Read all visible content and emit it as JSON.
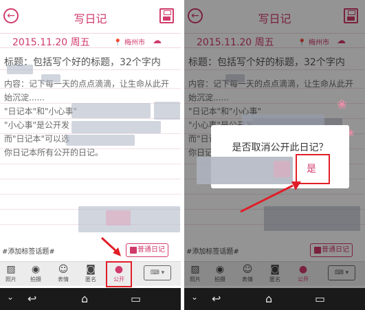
{
  "left": {
    "title": "写日记",
    "date": "2015.11.20 周五",
    "location": "梅州市",
    "weather_icon": "cloud-sun-icon",
    "title_placeholder": "标题：包括写个好的标题，32个字内",
    "content_lines": [
      "内容：记下每一天的点点滴滴，让生命从此开",
      "始沉淀......",
      "\"日记本\"和\"小心事\"",
      "\"小心事\"是公开发",
      "而\"日记本\"可以选",
      "你日记本所有公开的日记。"
    ],
    "tag_placeholder": "#添加标签话题#",
    "normal_diary_button": "普通日记",
    "toolbar": [
      {
        "label": "照片",
        "icon": "image-icon"
      },
      {
        "label": "拍摄",
        "icon": "camera-icon"
      },
      {
        "label": "表情",
        "icon": "smiley-icon"
      },
      {
        "label": "匿名",
        "icon": "anonymous-icon"
      },
      {
        "label": "公开",
        "icon": "people-icon"
      }
    ],
    "keyboard_icon": "keyboard-icon"
  },
  "right": {
    "title": "写日记",
    "date": "2015.11.20 周五",
    "location": "梅州市",
    "title_placeholder": "标题：包括写个好的标题，32个字内",
    "content_lines": [
      "内容：记下每一天的点点滴滴，让生命从此开",
      "始沉淀......",
      "\"日记本\"和\"小心事\"",
      "\"小心事\"是公开发",
      "而\"日记本\"可以",
      "你日记本所有公开"
    ],
    "dialog": {
      "message": "是否取消公开此日记？",
      "confirm": "是"
    },
    "tag_placeholder": "#添加标签话题#",
    "normal_diary_button": "普通日记",
    "toolbar": [
      {
        "label": "照片"
      },
      {
        "label": "拍摄"
      },
      {
        "label": "表情"
      },
      {
        "label": "匿名"
      },
      {
        "label": "公开"
      }
    ]
  },
  "colors": {
    "accent": "#d03a6a",
    "highlight_box": "#e01e28",
    "navbar": "#1a1a1a"
  }
}
